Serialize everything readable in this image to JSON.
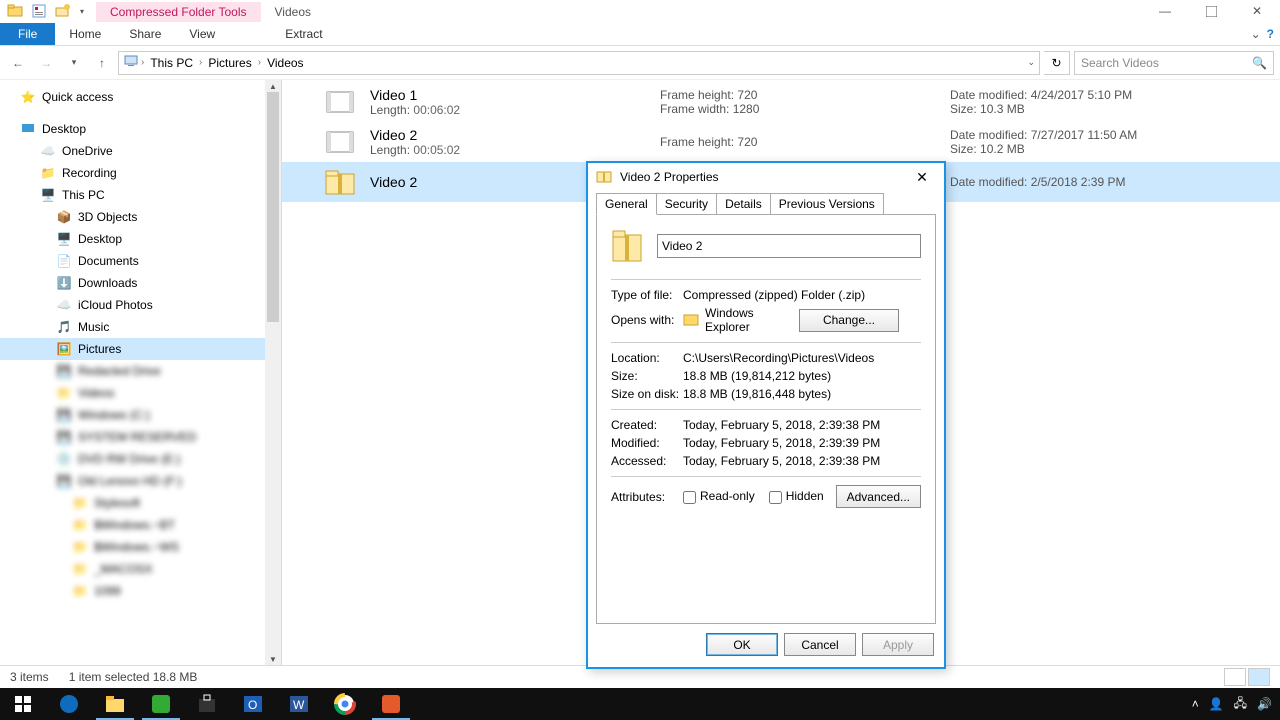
{
  "titlebar": {
    "contextual_tab": "Compressed Folder Tools",
    "title_tab": "Videos"
  },
  "ribbon": {
    "file": "File",
    "home": "Home",
    "share": "Share",
    "view": "View",
    "extract": "Extract"
  },
  "addressbar": {
    "seg0": "This PC",
    "seg1": "Pictures",
    "seg2": "Videos",
    "search_placeholder": "Search Videos"
  },
  "nav": {
    "quick_access": "Quick access",
    "desktop": "Desktop",
    "onedrive": "OneDrive",
    "recording": "Recording",
    "this_pc": "This PC",
    "objects3d": "3D Objects",
    "desktop2": "Desktop",
    "documents": "Documents",
    "downloads": "Downloads",
    "icloud": "iCloud Photos",
    "music": "Music",
    "pictures": "Pictures"
  },
  "files": [
    {
      "name": "Video 1",
      "length_k": "Length:",
      "length_v": "00:06:02",
      "fh_k": "Frame height:",
      "fh_v": "720",
      "fw_k": "Frame width:",
      "fw_v": "1280",
      "dm_k": "Date modified:",
      "dm_v": "4/24/2017 5:10 PM",
      "sz_k": "Size:",
      "sz_v": "10.3 MB"
    },
    {
      "name": "Video 2",
      "length_k": "Length:",
      "length_v": "00:05:02",
      "fh_k": "Frame height:",
      "fh_v": "720",
      "dm_k": "Date modified:",
      "dm_v": "7/27/2017 11:50 AM",
      "sz_k": "Size:",
      "sz_v": "10.2 MB"
    },
    {
      "name": "Video 2",
      "dm_k": "Date modified:",
      "dm_v": "2/5/2018 2:39 PM"
    }
  ],
  "statusbar": {
    "count": "3 items",
    "selection": "1 item selected  18.8 MB"
  },
  "dialog": {
    "title": "Video 2 Properties",
    "tabs": {
      "general": "General",
      "security": "Security",
      "details": "Details",
      "prev": "Previous Versions"
    },
    "name_value": "Video 2",
    "type_k": "Type of file:",
    "type_v": "Compressed (zipped) Folder (.zip)",
    "opens_k": "Opens with:",
    "opens_v": "Windows Explorer",
    "change": "Change...",
    "loc_k": "Location:",
    "loc_v": "C:\\Users\\Recording\\Pictures\\Videos",
    "size_k": "Size:",
    "size_v": "18.8 MB (19,814,212 bytes)",
    "sod_k": "Size on disk:",
    "sod_v": "18.8 MB (19,816,448 bytes)",
    "created_k": "Created:",
    "created_v": "Today, February 5, 2018, 2:39:38 PM",
    "modified_k": "Modified:",
    "modified_v": "Today, February 5, 2018, 2:39:39 PM",
    "accessed_k": "Accessed:",
    "accessed_v": "Today, February 5, 2018, 2:39:38 PM",
    "attrs_k": "Attributes:",
    "readonly": "Read-only",
    "hidden": "Hidden",
    "advanced": "Advanced...",
    "ok": "OK",
    "cancel": "Cancel",
    "apply": "Apply"
  }
}
